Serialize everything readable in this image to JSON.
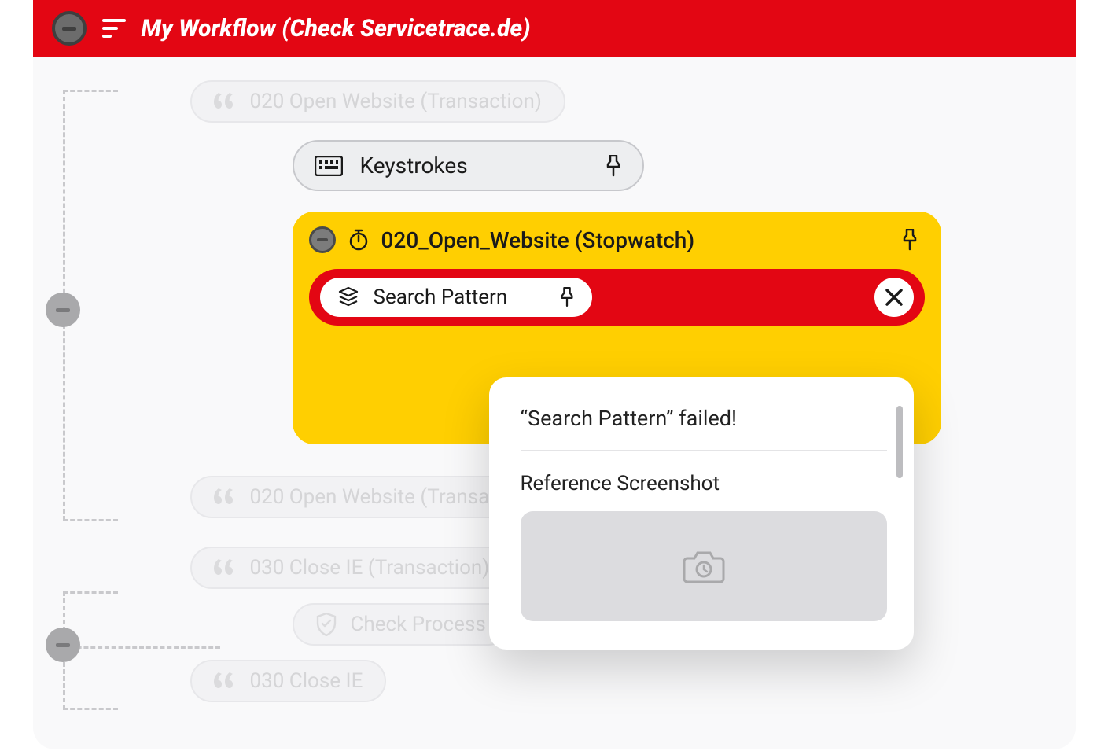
{
  "header": {
    "title": "My Workflow (Check Servicetrace.de)"
  },
  "nodes": {
    "open_website_tx_a": "020 Open Website (Transaction)",
    "keystrokes": "Keystrokes",
    "stopwatch": "020_Open_Website (Stopwatch)",
    "search_pattern": "Search Pattern",
    "open_website_tx_b": "020 Open Website (Transaction)",
    "close_ie_tx": "030 Close IE (Transaction)",
    "check_process": "Check Process",
    "close_ie": "030 Close IE"
  },
  "popup": {
    "title": "“Search Pattern” failed!",
    "section": "Reference Screenshot"
  }
}
